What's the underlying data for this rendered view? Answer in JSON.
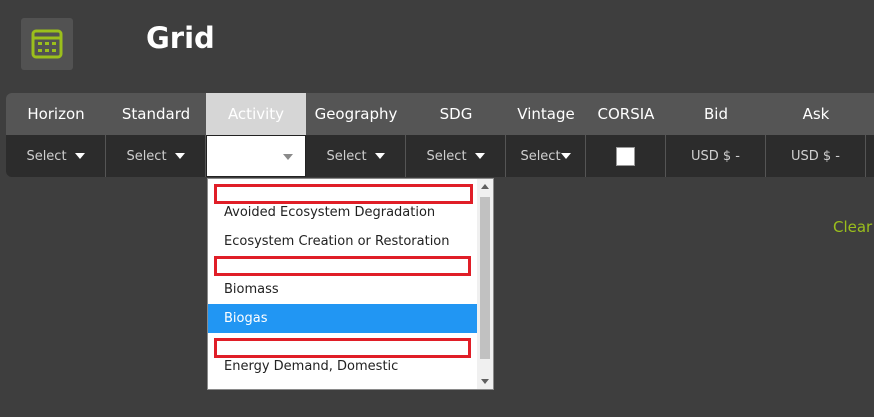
{
  "header": {
    "title": "Grid",
    "icon": "calendar-grid-icon",
    "icon_color": "#9bbf1c"
  },
  "columns": [
    {
      "label": "Horizon",
      "filter": "Select"
    },
    {
      "label": "Standard",
      "filter": "Select"
    },
    {
      "label": "Activity",
      "filter": ""
    },
    {
      "label": "Geography",
      "filter": "Select"
    },
    {
      "label": "SDG",
      "filter": "Select"
    },
    {
      "label": "Vintage",
      "filter": "Select"
    },
    {
      "label": "CORSIA",
      "filter": ""
    },
    {
      "label": "Bid",
      "filter": "USD $ -"
    },
    {
      "label": "Ask",
      "filter": "USD $ -"
    }
  ],
  "clear_label": "Clear",
  "dropdown": {
    "options": [
      {
        "label": "",
        "redacted": true
      },
      {
        "label": "Avoided Ecosystem Degradation",
        "redacted": false
      },
      {
        "label": "Ecosystem Creation or Restoration",
        "redacted": false
      },
      {
        "label": "",
        "redacted": true
      },
      {
        "label": "Biomass",
        "redacted": false
      },
      {
        "label": "Biogas",
        "redacted": false,
        "selected": true
      },
      {
        "label": "",
        "redacted": true
      },
      {
        "label": "Energy Demand, Domestic",
        "redacted": false
      }
    ]
  },
  "colors": {
    "accent": "#9bbf1c",
    "selected": "#2196f3",
    "redaction": "#e01e27"
  }
}
